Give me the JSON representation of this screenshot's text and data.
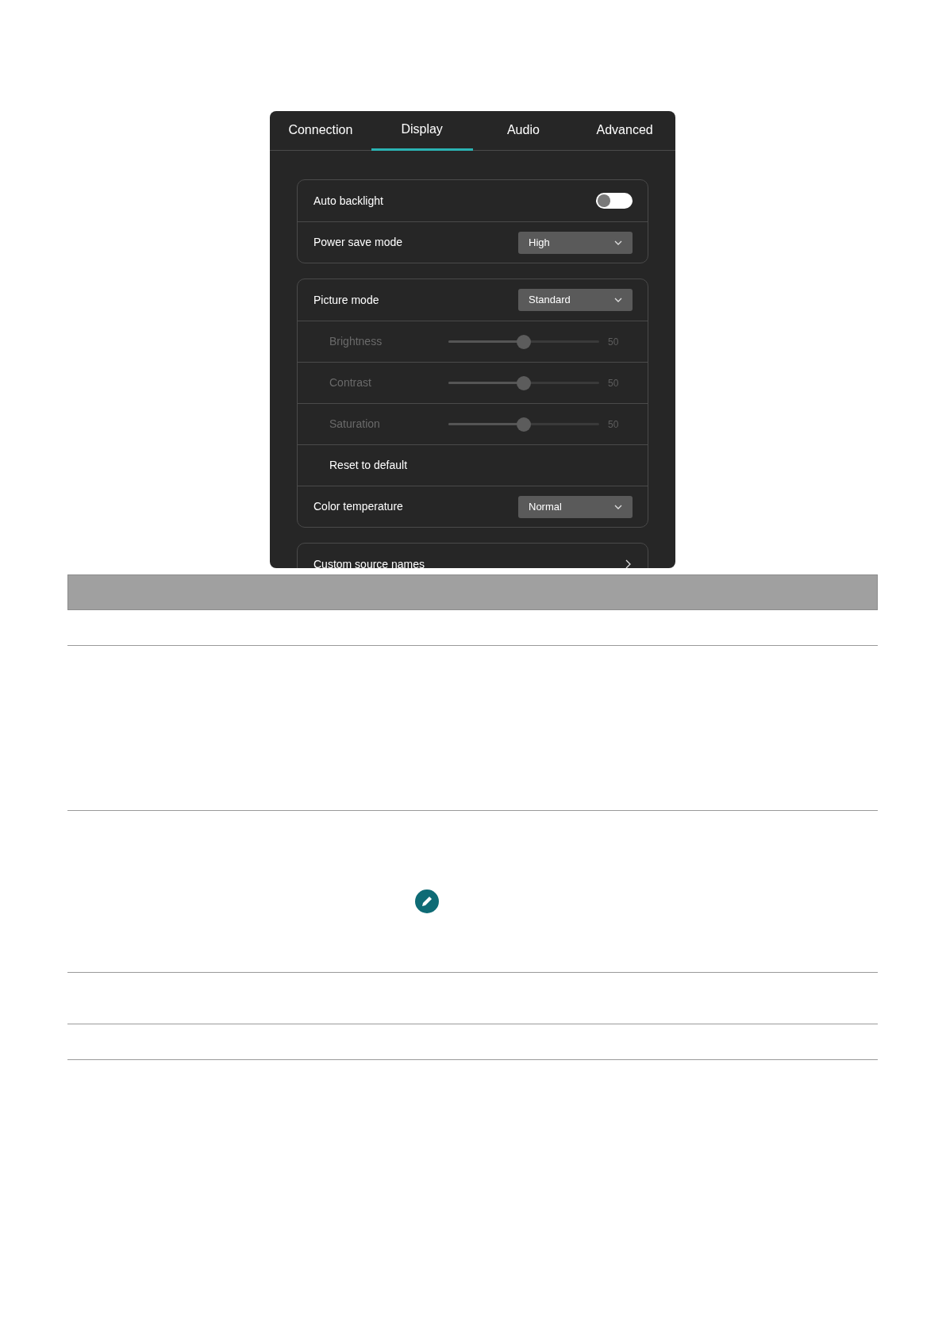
{
  "tabs": [
    {
      "label": "Connection",
      "selected": false
    },
    {
      "label": "Display",
      "selected": true
    },
    {
      "label": "Audio",
      "selected": false
    },
    {
      "label": "Advanced",
      "selected": false
    }
  ],
  "groups": [
    {
      "rows": [
        {
          "kind": "toggle",
          "label": "Auto backlight",
          "on": false
        },
        {
          "kind": "select",
          "label": "Power save mode",
          "value": "High"
        }
      ]
    },
    {
      "rows": [
        {
          "kind": "select",
          "label": "Picture mode",
          "value": "Standard"
        },
        {
          "kind": "slider",
          "label": "Brightness",
          "level": 0.5,
          "reading": "50",
          "disabled": true
        },
        {
          "kind": "slider",
          "label": "Contrast",
          "level": 0.5,
          "reading": "50",
          "disabled": true
        },
        {
          "kind": "slider",
          "label": "Saturation",
          "level": 0.5,
          "reading": "50",
          "disabled": true
        },
        {
          "kind": "action",
          "label": "Reset to default"
        },
        {
          "kind": "select",
          "label": "Color temperature",
          "value": "Normal"
        }
      ]
    },
    {
      "rows": [
        {
          "kind": "link",
          "label": "Custom source names"
        }
      ]
    }
  ]
}
